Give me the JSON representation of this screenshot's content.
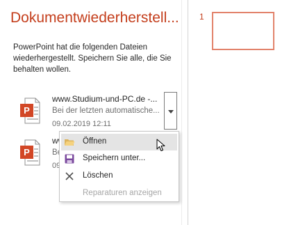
{
  "recovery_pane": {
    "title": "Dokumentwiederherstell...",
    "description": "PowerPoint hat die folgenden Dateien wiederhergestellt. Speichern Sie alle, die Sie behalten wollen.",
    "files": [
      {
        "name": "www.Studium-und-PC.de -...",
        "status": "Bei der letzten automatische...",
        "date": "09.02.2019 12:11",
        "icon": "powerpoint-file-icon"
      },
      {
        "name": "ww",
        "status": "Be",
        "date": "09",
        "icon": "powerpoint-file-icon"
      }
    ]
  },
  "slide_panel": {
    "slide_number": "1"
  },
  "context_menu": {
    "items": [
      {
        "label": "Öffnen",
        "icon": "folder-open-icon",
        "enabled": true,
        "highlighted": true
      },
      {
        "label": "Speichern unter...",
        "icon": "save-icon",
        "enabled": true,
        "highlighted": false
      },
      {
        "label": "Löschen",
        "icon": "close-x-icon",
        "enabled": true,
        "highlighted": false
      },
      {
        "label": "Reparaturen anzeigen",
        "icon": "",
        "enabled": false,
        "highlighted": false
      }
    ]
  },
  "colors": {
    "accent": "#c43e1c",
    "thumbnail_border": "#e2826b",
    "menu_highlight": "#e4e4e4",
    "disabled_text": "#a6a6a6"
  }
}
